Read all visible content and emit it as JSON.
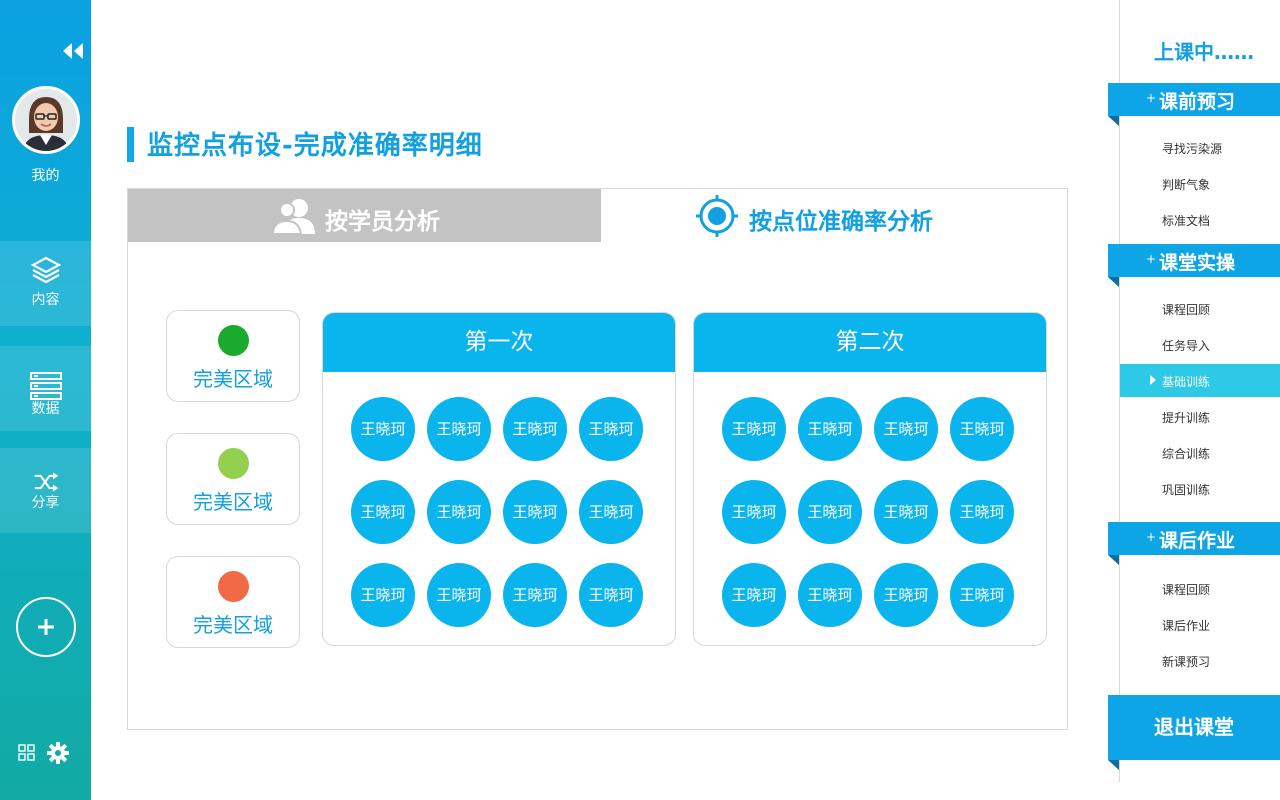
{
  "colors": {
    "accent": "#12a0e0",
    "bubble": "#0ab4ec",
    "tab_inactive": "#c3c3c3",
    "active_menu": "#2ec9e6"
  },
  "sidebar": {
    "me_label": "我的",
    "nav": [
      {
        "label": "内容",
        "icon": "layers-icon"
      },
      {
        "label": "数据",
        "icon": "server-icon"
      },
      {
        "label": "分享",
        "icon": "shuffle-icon"
      }
    ]
  },
  "main": {
    "title": "监控点布设-完成准确率明细",
    "tabs": [
      {
        "label": "按学员分析",
        "icon": "users-icon",
        "active": false
      },
      {
        "label": "按点位准确率分析",
        "icon": "target-icon",
        "active": true
      }
    ],
    "legend": [
      {
        "label": "完美区域",
        "color": "#1aaa2e"
      },
      {
        "label": "完美区域",
        "color": "#94d050"
      },
      {
        "label": "完美区域",
        "color": "#ef6a45"
      }
    ],
    "sessions": [
      {
        "title": "第一次",
        "students": [
          "王晓珂",
          "王晓珂",
          "王晓珂",
          "王晓珂",
          "王晓珂",
          "王晓珂",
          "王晓珂",
          "王晓珂",
          "王晓珂",
          "王晓珂",
          "王晓珂",
          "王晓珂"
        ]
      },
      {
        "title": "第二次",
        "students": [
          "王晓珂",
          "王晓珂",
          "王晓珂",
          "王晓珂",
          "王晓珂",
          "王晓珂",
          "王晓珂",
          "王晓珂",
          "王晓珂",
          "王晓珂",
          "王晓珂",
          "王晓珂"
        ]
      }
    ]
  },
  "right_panel": {
    "status": "上课中……",
    "sections": [
      {
        "label": "课前预习",
        "items": [
          "寻找污染源",
          "判断气象",
          "标准文档"
        ]
      },
      {
        "label": "课堂实操",
        "items": [
          "课程回顾",
          "任务导入",
          "基础训练",
          "提升训练",
          "综合训练",
          "巩固训练"
        ],
        "active_item": "基础训练"
      },
      {
        "label": "课后作业",
        "items": [
          "课程回顾",
          "课后作业",
          "新课预习"
        ]
      }
    ],
    "exit_label": "退出课堂"
  }
}
